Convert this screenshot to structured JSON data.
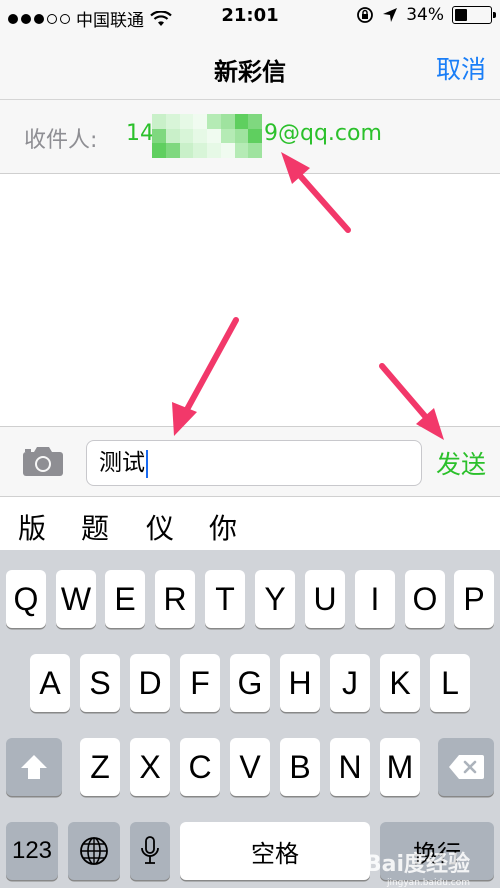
{
  "status_bar": {
    "carrier": "中国联通",
    "time": "21:01",
    "battery_text": "34%",
    "battery_level": 0.34
  },
  "nav": {
    "title": "新彩信",
    "cancel_label": "取消"
  },
  "recipient": {
    "label": "收件人:",
    "prefix": "14",
    "suffix": "9@qq.com"
  },
  "compose": {
    "text": "测试",
    "send_label": "发送"
  },
  "candidates": [
    "版",
    "题",
    "仪",
    "你"
  ],
  "keyboard": {
    "row1": [
      "Q",
      "W",
      "E",
      "R",
      "T",
      "Y",
      "U",
      "I",
      "O",
      "P"
    ],
    "row2": [
      "A",
      "S",
      "D",
      "F",
      "G",
      "H",
      "J",
      "K",
      "L"
    ],
    "row3": [
      "Z",
      "X",
      "C",
      "V",
      "B",
      "N",
      "M"
    ],
    "numbers_label": "123",
    "space_label": "空格",
    "return_label": "换行"
  },
  "watermark": {
    "brand": "Bai度经验",
    "domain": "jingyan.baidu.com"
  },
  "colors": {
    "accent_blue": "#1a7ef7",
    "accent_green": "#2bc02b",
    "arrow_pink": "#f2386a"
  }
}
